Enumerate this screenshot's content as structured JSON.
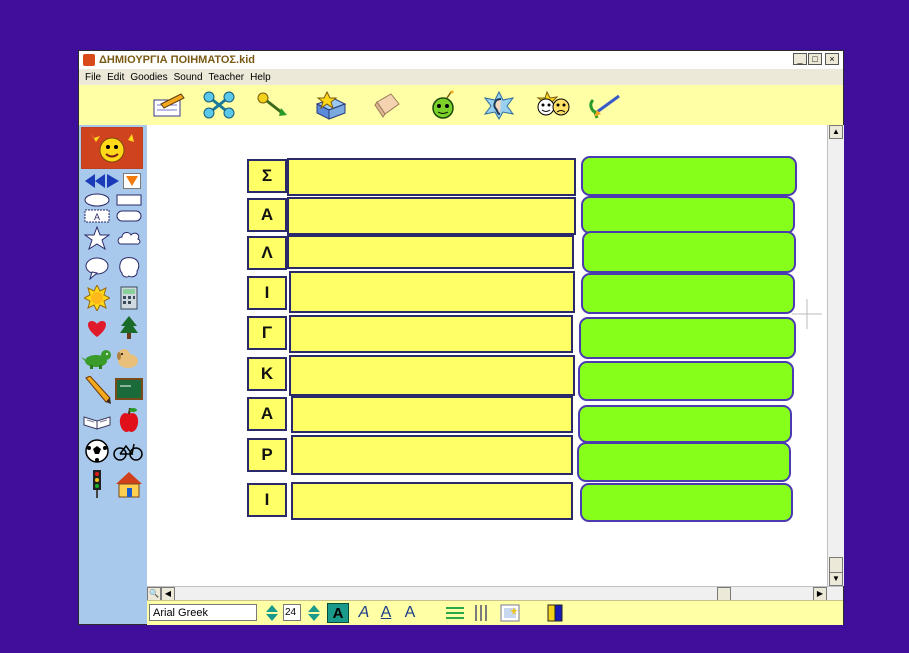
{
  "window": {
    "title": "ΔΗΜΙΟΥΡΓΙΑ ΠΟΙΗΜΑΤΟΣ.kid",
    "minimize": "_",
    "maximize": "□",
    "close": "×"
  },
  "menu": [
    "File",
    "Edit",
    "Goodies",
    "Sound",
    "Teacher",
    "Help"
  ],
  "toolbar": {
    "icons": [
      "pencil-icon",
      "link-tool-icon",
      "magic-wand-icon",
      "stamp-box-icon",
      "eraser-icon",
      "bomb-icon",
      "ear-icon",
      "faces-icon",
      "paintbrush-icon"
    ]
  },
  "palette": {
    "icons": [
      "sun-face-icon",
      "arrow-left-icon",
      "arrow-right-icon",
      "arrow-down-icon",
      "oval-icon",
      "rectangle-icon",
      "text-box-icon",
      "rounded-rect-icon",
      "star-icon",
      "cloud-icon",
      "speech-bubble-icon",
      "thought-bubble-icon",
      "sun-icon",
      "calculator-icon",
      "heart-icon",
      "tree-icon",
      "dinosaur-icon",
      "dog-icon",
      "pencil-icon",
      "chalkboard-icon",
      "book-icon",
      "apple-icon",
      "soccer-ball-icon",
      "bicycle-icon",
      "traffic-light-icon",
      "house-icon"
    ]
  },
  "acrostic": {
    "letters": [
      "Σ",
      "Α",
      "Λ",
      "Ι",
      "Γ",
      "Κ",
      "Α",
      "Ρ",
      "Ι"
    ]
  },
  "format_bar": {
    "font": "Arial Greek",
    "size": "24",
    "bold_label": "A",
    "italic_label": "A",
    "underline_label": "A",
    "format_label": "A"
  },
  "colors": {
    "desktop": "#3f0f9c",
    "toolbar": "#ffffa6",
    "palette": "#a8c8ec",
    "yellow_box": "#ffff66",
    "green_box": "#86ff1a",
    "border": "#2a2a6a"
  }
}
